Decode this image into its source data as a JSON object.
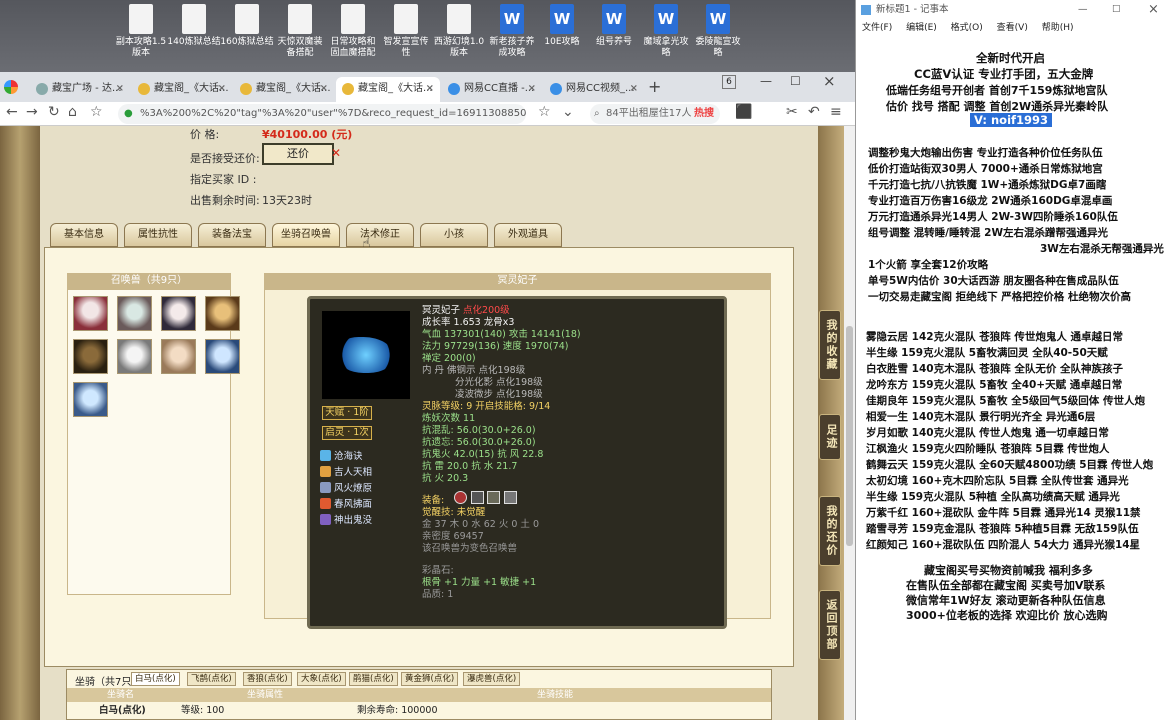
{
  "desktop": {
    "icons": [
      {
        "label": "副本攻略1.5 版本",
        "type": "doc"
      },
      {
        "label": "140炼狱总结",
        "type": "doc"
      },
      {
        "label": "160炼狱总结",
        "type": "doc"
      },
      {
        "label": "天惊双魔装 备搭配",
        "type": "doc"
      },
      {
        "label": "日常攻略和 固血魔搭配",
        "type": "doc"
      },
      {
        "label": "智发宣宣传 性",
        "type": "doc"
      },
      {
        "label": "西游幻境1.0 版本",
        "type": "doc"
      },
      {
        "label": "新老孩子养 成攻略",
        "type": "word"
      },
      {
        "label": "10E攻略",
        "type": "word"
      },
      {
        "label": "组号养号",
        "type": "word"
      },
      {
        "label": "魔域拿光攻 略",
        "type": "word"
      },
      {
        "label": "委陵龍宣攻 略",
        "type": "word"
      }
    ]
  },
  "browser": {
    "tabs": [
      {
        "label": "藏宝广场 - 达..."
      },
      {
        "label": "藏宝阁_《大话..."
      },
      {
        "label": "藏宝阁_《大话..."
      },
      {
        "label": "藏宝阁_《大话..."
      },
      {
        "label": "网易CC直播 -..."
      },
      {
        "label": "网易CC视频_..."
      }
    ],
    "tab_count": "6",
    "url": "%3A%200%2C%20\"tag\"%3A%20\"user\"%7D&reco_request_id=1691130885055VPI8w",
    "search_placeholder": "84平出租屋住17人",
    "hot": "热搜"
  },
  "listing": {
    "price_label": "价          格:",
    "price": "¥40100.00 (元)",
    "counter_label": "是否接受还价:",
    "counter_button": "还价",
    "buyer_label": "指定买家 ID :",
    "time_label": "出售剩余时间:",
    "time_value": "13天23时"
  },
  "game_tabs": [
    "基本信息",
    "属性抗性",
    "装备法宝",
    "坐骑召唤兽",
    "法术修正",
    "小孩",
    "外观道具"
  ],
  "pets": {
    "header": "召唤兽（共9只）",
    "detail_header": "冥灵妃子"
  },
  "pet_card": {
    "name": "冥灵妃子",
    "tag": "点化200级",
    "growth": "成长率 1.653  龙骨x3",
    "hp": "气血 137301(140)  攻击 14141(18)",
    "mp": "法力 97729(136)  速度 1970(74)",
    "zen": "禅定 200(0)",
    "inner1": "内   丹  佛钢示 点化198级",
    "inner2": "分光化影 点化198级",
    "inner3": "凌波微步 点化198级",
    "spirit": "灵脉等级:  9  开启技能格:  9/14",
    "cultivate": "炼妖次数 11",
    "res1": "抗混乱: 56.0(30.0+26.0)",
    "res2": "抗遗忘: 56.0(30.0+26.0)",
    "res3": "抗鬼火 42.0(15)  抗   风 22.8",
    "res4": "抗   雷 20.0  抗   水 21.7",
    "res5": "抗   火 20.3",
    "equip_label": "装备:",
    "awaken": "觉醒技:  未觉醒",
    "elements": "金 37 木 0 水 62 火 0 土 0",
    "intimacy": "亲密度 69457",
    "changed": "该召唤兽为变色召唤兽",
    "gem_label": "彩晶石:",
    "gem1": "根骨 +1 力量 +1 敏捷 +1",
    "gem2": "品质: 1",
    "badge1": "天赋 · 1阶",
    "badge2": "启灵 · 1次",
    "skills": [
      "沧海诀",
      "吉人天相",
      "风火燎原",
      "春风拂面",
      "神出鬼没"
    ]
  },
  "side_buttons": [
    "我的收藏",
    "足迹",
    "我的还价",
    "返回顶部"
  ],
  "mounts": {
    "label": "坐骑（共7只）",
    "tabs": [
      "白马(点化)",
      "飞鹊(点化)",
      "香狼(点化)",
      "大象(点化)",
      "鹃猫(点化)",
      "黄金狮(点化)",
      "瀑虎兽(点化)"
    ],
    "col1": "坐骑名",
    "col2": "坐骑属性",
    "col3": "坐骑技能",
    "row_name": "白马(点化)",
    "row_level": "等级: 100",
    "row_life": "剩余寿命: 100000"
  },
  "notepad": {
    "title": "新标题1 - 记事本",
    "menu": [
      "文件(F)",
      "编辑(E)",
      "格式(O)",
      "查看(V)",
      "帮助(H)"
    ],
    "lines": [
      "全新时代开启",
      "CC蓝V认证 专业打手团，五大金牌",
      "低端任务组号开创者           首创7千159炼狱地宫队",
      "估价 找号 搭配 调整           首创2W通杀异光秦岭队",
      "V: noif1993",
      "调整秒鬼大炮输出伤害           专业打造各种价位任务队伍",
      "低价打造站街双30男人           7000+通杀日常炼狱地宫",
      "千元打造七抗/八抗铁魔           1W+通杀炼狱DG卓7画瞎",
      "专业打造百万伤害16级龙           2W通杀160DG卓混卓画",
      "万元打造通杀异光14男人         2W-3W四阶睡杀160队伍",
      "组号调整 混转睡/睡转混           2W左右混杀蹭帮强通异光",
      "3W左右混杀无帮强通异光",
      "1个火箭 享全套12价攻略",
      "单号5W内估价 30大话西游        朋友圈各种在售成品队伍",
      "一切交易走藏宝阁 拒绝线下     严格把控价格 杜绝物次价高",
      "雾隐云居 142克火混队 苍狼阵 传世炮鬼人 通卓越日常",
      "半生缘     159克火混队 5畜牧满回灵 全队40-50天赋",
      "白衣胜雪 140克木混队 苍狼阵 全队无价 全队神族孩子",
      "龙吟东方 159克火混队 5畜牧 全40+天赋 通卓越日常",
      "佳期良年 159克火混队 5畜牧 全5级回气5级回体 传世人炮",
      "相爱一生 140克木混队 景行明光齐全 异光通6层",
      "岁月如歌 140克火混队 传世人炮鬼 通一切卓越日常",
      "江枫渔火 159克火四阶睡队 苍狼阵 5目霖 传世炮人",
      "鹤舞云天 159克火混队 全60天赋4800功绩 5目霖 传世人炮",
      "太初幻境 160+克木四阶忘队 5目霖 全队传世套 通异光",
      "半生缘     159克火混队 5种植 全队高功绩高天赋 通异光",
      "万紫千红 160+混砍队 金牛阵 5目霖 通异光14 灵猴11禁",
      "踏雪寻芳 159克金混队 苍狼阵 5种植5目霖 无敌159队伍",
      "红颜知己 160+混砍队伍 四阶混人 54大力 通异光猴14星",
      "藏宝阁买号买物资前喊我  福利多多",
      "在售队伍全部都在藏宝阁  买卖号加V联系",
      "微信常年1W好友 滚动更新各种队伍信息",
      "3000+位老板的选择 欢迎比价 放心选购"
    ]
  }
}
